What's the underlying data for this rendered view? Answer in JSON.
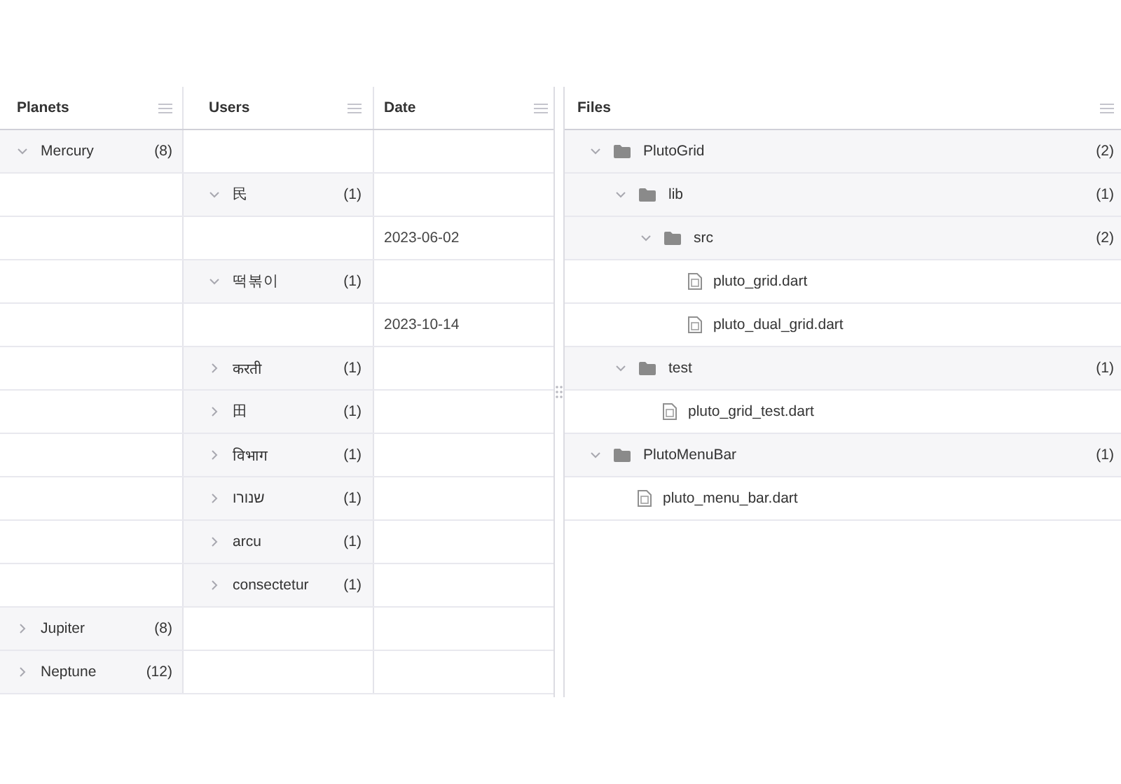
{
  "left_grid": {
    "columns": [
      {
        "title": "Planets"
      },
      {
        "title": "Users"
      },
      {
        "title": "Date"
      }
    ],
    "groups": [
      {
        "label": "Mercury",
        "count": "(8)",
        "expanded": true,
        "children": [
          {
            "label": "民",
            "count": "(1)",
            "expanded": true,
            "children": [
              {
                "date": "2023-06-02"
              }
            ]
          },
          {
            "label": "떡볶이",
            "count": "(1)",
            "expanded": true,
            "children": [
              {
                "date": "2023-10-14"
              }
            ]
          },
          {
            "label": "करती",
            "count": "(1)",
            "expanded": false
          },
          {
            "label": "田",
            "count": "(1)",
            "expanded": false
          },
          {
            "label": "विभाग",
            "count": "(1)",
            "expanded": false
          },
          {
            "label": "שנורו",
            "count": "(1)",
            "expanded": false
          },
          {
            "label": "arcu",
            "count": "(1)",
            "expanded": false
          },
          {
            "label": "consectetur",
            "count": "(1)",
            "expanded": false
          }
        ]
      },
      {
        "label": "Jupiter",
        "count": "(8)",
        "expanded": false
      },
      {
        "label": "Neptune",
        "count": "(12)",
        "expanded": false
      }
    ]
  },
  "right_grid": {
    "columns": [
      {
        "title": "Files"
      }
    ],
    "items": [
      {
        "kind": "folder",
        "label": "PlutoGrid",
        "count": "(2)",
        "expanded": true,
        "children": [
          {
            "kind": "folder",
            "label": "lib",
            "count": "(1)",
            "expanded": true,
            "children": [
              {
                "kind": "folder",
                "label": "src",
                "count": "(2)",
                "expanded": true,
                "children": [
                  {
                    "kind": "file",
                    "label": "pluto_grid.dart"
                  },
                  {
                    "kind": "file",
                    "label": "pluto_dual_grid.dart"
                  }
                ]
              }
            ]
          },
          {
            "kind": "folder",
            "label": "test",
            "count": "(1)",
            "expanded": true,
            "children": [
              {
                "kind": "file",
                "label": "pluto_grid_test.dart"
              }
            ]
          }
        ]
      },
      {
        "kind": "folder",
        "label": "PlutoMenuBar",
        "count": "(1)",
        "expanded": true,
        "children": [
          {
            "kind": "file",
            "label": "pluto_menu_bar.dart"
          }
        ]
      }
    ]
  }
}
